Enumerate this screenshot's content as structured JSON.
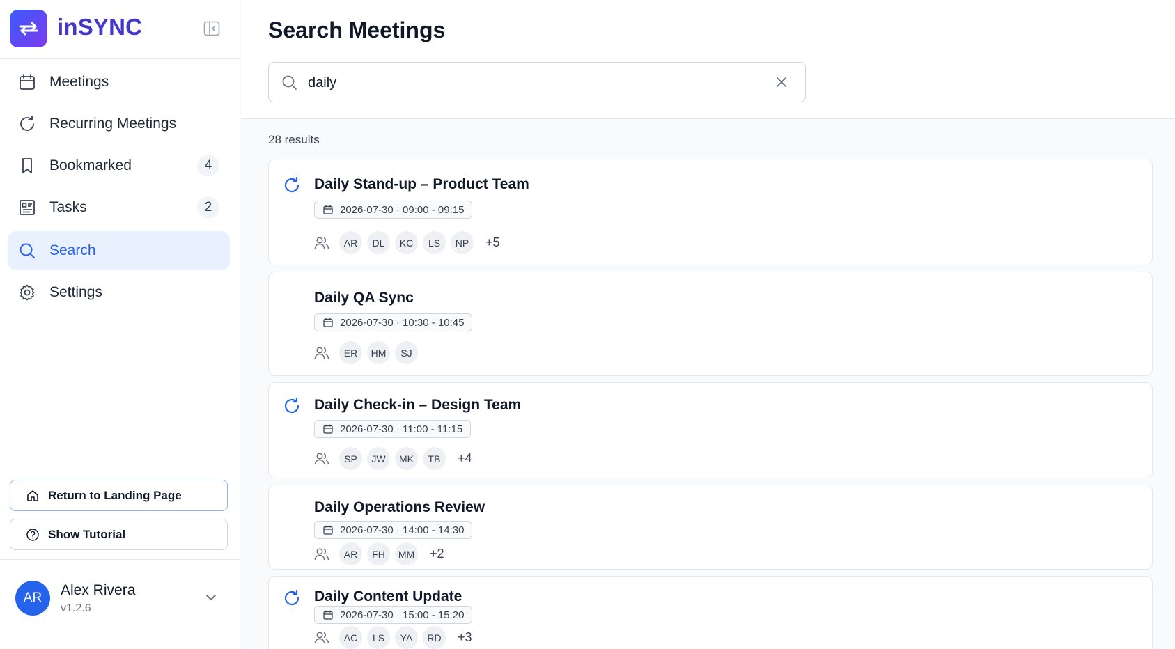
{
  "app": {
    "name": "inSYNC",
    "accent": "#2563eb",
    "brand_color": "#4338ca"
  },
  "sidebar": {
    "items": [
      {
        "label": "Meetings",
        "icon": "calendar-icon",
        "badge": null
      },
      {
        "label": "Recurring Meetings",
        "icon": "refresh-icon",
        "badge": null
      },
      {
        "label": "Bookmarked",
        "icon": "bookmark-icon",
        "badge": "4"
      },
      {
        "label": "Tasks",
        "icon": "tasks-icon",
        "badge": "2"
      },
      {
        "label": "Search",
        "icon": "search-icon",
        "badge": null,
        "active": true
      },
      {
        "label": "Settings",
        "icon": "gear-icon",
        "badge": null
      }
    ],
    "return_label": "Return to Landing Page",
    "tutorial_label": "Show Tutorial",
    "user": {
      "initials": "AR",
      "name": "Alex Rivera",
      "version": "v1.2.6"
    }
  },
  "main": {
    "title": "Search Meetings",
    "search": {
      "value": "daily"
    },
    "results_count": "28 results",
    "results": [
      {
        "title": "Daily Stand-up – Product Team",
        "datetime": "2026-07-30 · 09:00 - 09:15",
        "recurring": true,
        "participants": [
          "AR",
          "DL",
          "KC",
          "LS",
          "NP"
        ],
        "more": "+5"
      },
      {
        "title": "Daily QA Sync",
        "datetime": "2026-07-30 · 10:30 - 10:45",
        "recurring": false,
        "participants": [
          "ER",
          "HM",
          "SJ"
        ],
        "more": ""
      },
      {
        "title": "Daily Check-in – Design Team",
        "datetime": "2026-07-30 · 11:00 - 11:15",
        "recurring": true,
        "participants": [
          "SP",
          "JW",
          "MK",
          "TB"
        ],
        "more": "+4"
      },
      {
        "title": "Daily Operations Review",
        "datetime": "2026-07-30 · 14:00 - 14:30",
        "recurring": false,
        "participants": [
          "AR",
          "FH",
          "MM"
        ],
        "more": "+2"
      },
      {
        "title": "Daily Content Update",
        "datetime": "2026-07-30 · 15:00 - 15:20",
        "recurring": true,
        "participants": [
          "AC",
          "LS",
          "YA",
          "RD"
        ],
        "more": "+3"
      }
    ]
  }
}
